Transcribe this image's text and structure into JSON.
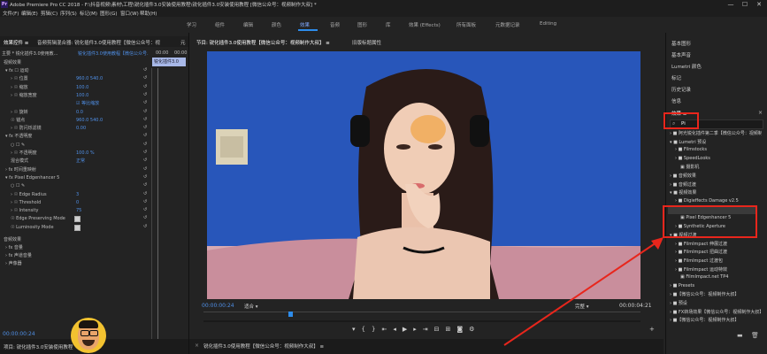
{
  "titlebar": {
    "title": "Adobe Premiere Pro CC 2018 - F:\\抖音视频\\素材\\工程\\锐化插件3.0安装使用教程\\锐化插件3.0安装使用教程 [微信公众号：视频制作大叔] *",
    "logo": "Pr",
    "minimize": "—",
    "maximize": "☐",
    "close": "✕"
  },
  "menu": [
    "文件(F)",
    "编辑(E)",
    "剪辑(C)",
    "序列(S)",
    "标记(M)",
    "图形(G)",
    "窗口(W)",
    "帮助(H)"
  ],
  "workspaces": [
    "学习",
    "组件",
    "编辑",
    "颜色",
    "效果",
    "音频",
    "图形",
    "库",
    "效果 (Effects)",
    "所有面板",
    "元数据记录",
    "Editing"
  ],
  "workspace_active": "效果",
  "left": {
    "tabs": [
      "效果控件 ≡",
      "音频剪辑混合器: 锐化插件3.0使用教程【微信公众号：视",
      "元"
    ],
    "master": "主要 * 锐化插件3.0使用教... ",
    "clip": "锐化插件3.0使用教程【微信公众号...",
    "ruler_time": "00:00",
    "clip_bar": "锐化插件3.0",
    "section_video": "视频效果",
    "rows": [
      {
        "indent": 6,
        "label": "▾ fx ☐ 运动",
        "value": ""
      },
      {
        "indent": 12,
        "label": "› ☉ 位置",
        "value": "960.0     540.0"
      },
      {
        "indent": 12,
        "label": "› ☉ 缩放",
        "value": "100.0"
      },
      {
        "indent": 12,
        "label": "› ☉ 缩放宽度",
        "value": "100.0"
      },
      {
        "indent": 12,
        "label": "",
        "value": "☑ 等比缩放"
      },
      {
        "indent": 12,
        "label": "› ☉ 旋转",
        "value": "0.0"
      },
      {
        "indent": 12,
        "label": "☉ 锚点",
        "value": "960.0     540.0"
      },
      {
        "indent": 12,
        "label": "› ☉ 防闪烁滤镜",
        "value": "0.00"
      },
      {
        "indent": 6,
        "label": "▾ fx 不透明度",
        "value": ""
      },
      {
        "indent": 12,
        "label": "○ ☐ ✎",
        "value": ""
      },
      {
        "indent": 12,
        "label": "› ☉ 不透明度",
        "value": "100.0 %"
      },
      {
        "indent": 12,
        "label": "混合模式",
        "value": "正常"
      },
      {
        "indent": 6,
        "label": "› fx 时间重映射",
        "value": ""
      },
      {
        "indent": 6,
        "label": "▾ fx Pixel Edgenhancer 5",
        "value": ""
      },
      {
        "indent": 12,
        "label": "○ ☐ ✎",
        "value": ""
      },
      {
        "indent": 12,
        "label": "› ☉ Edge Radius",
        "value": "3"
      },
      {
        "indent": 12,
        "label": "› ☉ Threshold",
        "value": "0"
      },
      {
        "indent": 12,
        "label": "› ☉ Intensity",
        "value": "75"
      },
      {
        "indent": 12,
        "label": "☉ Edge Preserving Mode",
        "value": ""
      },
      {
        "indent": 12,
        "label": "☉ Luminosity Mode",
        "value": ""
      }
    ],
    "section_audio": "音频效果",
    "audio_rows": [
      "› fx 音量",
      "› fx 声道音量",
      "› 声像器"
    ],
    "timecode": "00:00:00:24",
    "sequence_tab": "项目: 锐化插件3.0安装使用教程"
  },
  "monitor": {
    "tabs": [
      "节目: 锐化插件3.0使用教程【微信公众号：视频制作大叔】 ≡",
      "旧版标题属性"
    ],
    "timecode_left": "00:00:00:24",
    "fit": "适合",
    "quality": "完整",
    "timecode_right": "00:00:04:21",
    "sequence_label": "锐化插件3.0使用教程【微信公众号：视频制作大叔】 ≡"
  },
  "right": {
    "items": [
      "基本图形",
      "基本声音",
      "Lumetri 颜色",
      "标记",
      "历史记录",
      "信息"
    ],
    "effects_tab": "效果 ≡",
    "search_value": "Pi",
    "tree": [
      {
        "x": 4,
        "t": "› ■ 阿光锐化插件第二季【微信公众号：视频制作大"
      },
      {
        "x": 4,
        "t": "▾ ■ Lumetri 预设"
      },
      {
        "x": 10,
        "t": "› ■ Filmstocks"
      },
      {
        "x": 10,
        "t": "› ■ SpeedLooks"
      },
      {
        "x": 16,
        "t": "▣ 摄影机"
      },
      {
        "x": 4,
        "t": "› ■ 音频效果"
      },
      {
        "x": 4,
        "t": "› ■ 音频过渡"
      },
      {
        "x": 4,
        "t": "▾ ■ 视频效果"
      },
      {
        "x": 10,
        "t": "› ■ Digieffects Damage v2.5"
      },
      {
        "x": 10,
        "t": "▾ ■ Pixel Algorithms"
      },
      {
        "x": 16,
        "t": "▣ Pixel Edgenhancer 5"
      },
      {
        "x": 10,
        "t": "› ■ Synthetic Aperture"
      },
      {
        "x": 4,
        "t": "▾ ■ 视频过渡"
      },
      {
        "x": 10,
        "t": "› ■ FilmImpact 伸展过渡"
      },
      {
        "x": 10,
        "t": "› ■ FilmImpact 扭曲过渡"
      },
      {
        "x": 10,
        "t": "› ■ FilmImpact 过渡包"
      },
      {
        "x": 10,
        "t": "› ■ FilmImpact 运动特效"
      },
      {
        "x": 16,
        "t": "▣ FilmImpact.net TP4"
      },
      {
        "x": 4,
        "t": "› ■ Presets"
      },
      {
        "x": 4,
        "t": "› ■【微信公众号：视频制作大叔】"
      },
      {
        "x": 4,
        "t": "› ■ 预设"
      },
      {
        "x": 4,
        "t": "› ■ FX转场效果【微信公众号：视频制作大叔】"
      },
      {
        "x": 4,
        "t": "› ■【微信公众号：视频制作大叔】"
      }
    ]
  },
  "colors": {
    "accent": "#2d8ceb",
    "timecode": "#4f8fe6",
    "annotation": "#e8261c",
    "backdrop": "#2d5ec7"
  }
}
